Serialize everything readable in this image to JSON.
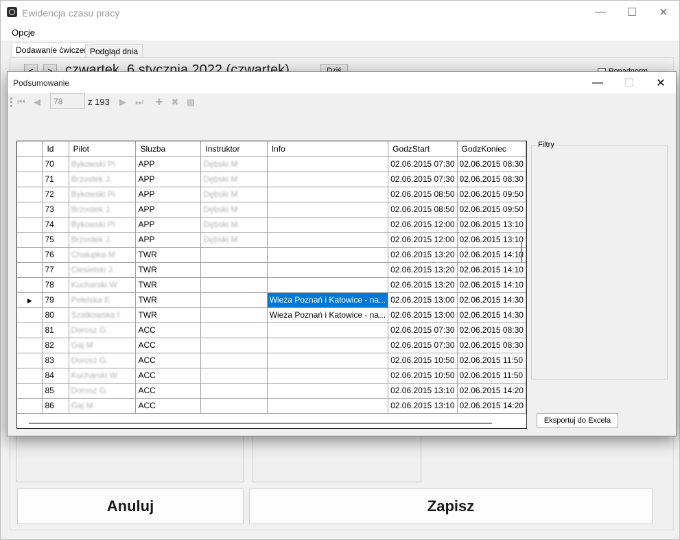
{
  "main": {
    "title": "Ewidencja czasu pracy",
    "menu": [
      "Opcje"
    ],
    "tabs": [
      {
        "label": "Dodawanie ćwiczeń",
        "active": true
      },
      {
        "label": "Podgląd dnia",
        "active": false
      }
    ],
    "prev_label": "<",
    "next_label": ">",
    "date_text": "czwartek, 6 stycznia 2022 (czwartek)",
    "today_label": "Dziś",
    "checkbox_label": "Ponadnorm",
    "cancel_label": "Anuluj",
    "save_label": "Zapisz"
  },
  "dialog": {
    "title": "Podsumowanie",
    "position_value": "78",
    "of_label": "z 193",
    "filters_label": "Filtry",
    "export_label": "Eksportuj do Excela",
    "columns": [
      "",
      "Id",
      "Pilot",
      "Sluzba",
      "Instruktor",
      "Info",
      "GodzStart",
      "GodzKoniec"
    ],
    "rows": [
      {
        "current": false,
        "id": "70",
        "pilot": "Bykowski Pi",
        "sluzba": "APP",
        "instruktor": "Dębski M",
        "info": "",
        "start": "02.06.2015 07:30",
        "end": "02.06.2015 08:30"
      },
      {
        "current": false,
        "id": "71",
        "pilot": "Brzostek J.",
        "sluzba": "APP",
        "instruktor": "Dębski M",
        "info": "",
        "start": "02.06.2015 07:30",
        "end": "02.06.2015 08:30"
      },
      {
        "current": false,
        "id": "72",
        "pilot": "Bykowski Pi",
        "sluzba": "APP",
        "instruktor": "Dębski M",
        "info": "",
        "start": "02.06.2015 08:50",
        "end": "02.06.2015 09:50"
      },
      {
        "current": false,
        "id": "73",
        "pilot": "Brzostek J.",
        "sluzba": "APP",
        "instruktor": "Dębski M",
        "info": "",
        "start": "02.06.2015 08:50",
        "end": "02.06.2015 09:50"
      },
      {
        "current": false,
        "id": "74",
        "pilot": "Bykowski Pi",
        "sluzba": "APP",
        "instruktor": "Dębski M",
        "info": "",
        "start": "02.06.2015 12:00",
        "end": "02.06.2015 13:10"
      },
      {
        "current": false,
        "id": "75",
        "pilot": "Brzostek J.",
        "sluzba": "APP",
        "instruktor": "Dębski M",
        "info": "",
        "start": "02.06.2015 12:00",
        "end": "02.06.2015 13:10"
      },
      {
        "current": false,
        "id": "76",
        "pilot": "Chałupka M",
        "sluzba": "TWR",
        "instruktor": "",
        "info": "",
        "start": "02.06.2015 13:20",
        "end": "02.06.2015 14:10"
      },
      {
        "current": false,
        "id": "77",
        "pilot": "Ciesielski J.",
        "sluzba": "TWR",
        "instruktor": "",
        "info": "",
        "start": "02.06.2015 13:20",
        "end": "02.06.2015 14:10"
      },
      {
        "current": false,
        "id": "78",
        "pilot": "Kucharski W",
        "sluzba": "TWR",
        "instruktor": "",
        "info": "",
        "start": "02.06.2015 13:20",
        "end": "02.06.2015 14:10"
      },
      {
        "current": true,
        "id": "79",
        "pilot": "Pełelska E",
        "sluzba": "TWR",
        "instruktor": "",
        "info": "Wieża Poznań i Katowice - na...",
        "start": "02.06.2015 13:00",
        "end": "02.06.2015 14:30"
      },
      {
        "current": false,
        "id": "80",
        "pilot": "Szatkowska I",
        "sluzba": "TWR",
        "instruktor": "",
        "info": "Wieża Poznań i Katowice - na...",
        "start": "02.06.2015 13:00",
        "end": "02.06.2015 14:30"
      },
      {
        "current": false,
        "id": "81",
        "pilot": "Dorosz G.",
        "sluzba": "ACC",
        "instruktor": "",
        "info": "",
        "start": "02.06.2015 07:30",
        "end": "02.06.2015 08:30"
      },
      {
        "current": false,
        "id": "82",
        "pilot": "Gaj M",
        "sluzba": "ACC",
        "instruktor": "",
        "info": "",
        "start": "02.06.2015 07:30",
        "end": "02.06.2015 08:30"
      },
      {
        "current": false,
        "id": "83",
        "pilot": "Dorosz G.",
        "sluzba": "ACC",
        "instruktor": "",
        "info": "",
        "start": "02.06.2015 10:50",
        "end": "02.06.2015 11:50"
      },
      {
        "current": false,
        "id": "84",
        "pilot": "Kucharski W",
        "sluzba": "ACC",
        "instruktor": "",
        "info": "",
        "start": "02.06.2015 10:50",
        "end": "02.06.2015 11:50"
      },
      {
        "current": false,
        "id": "85",
        "pilot": "Dorosz G.",
        "sluzba": "ACC",
        "instruktor": "",
        "info": "",
        "start": "02.06.2015 13:10",
        "end": "02.06.2015 14:20"
      },
      {
        "current": false,
        "id": "86",
        "pilot": "Gaj M",
        "sluzba": "ACC",
        "instruktor": "",
        "info": "",
        "start": "02.06.2015 13:10",
        "end": "02.06.2015 14:20"
      }
    ],
    "selected_info_row": "79"
  }
}
